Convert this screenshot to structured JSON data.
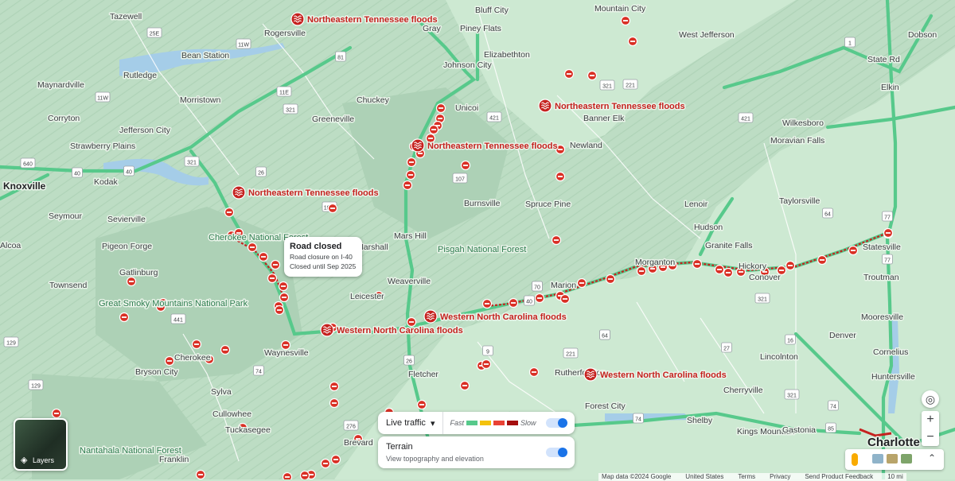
{
  "colors": {
    "highway": "#57c98b",
    "traffic_red": "#c5221f",
    "event": "#c5221f",
    "water": "#a5cde8"
  },
  "cities": [
    {
      "name": "Tazewell"
    },
    {
      "name": "Rogersville"
    },
    {
      "name": "Bean Station"
    },
    {
      "name": "Maynardville"
    },
    {
      "name": "Rutledge"
    },
    {
      "name": "Morristown"
    },
    {
      "name": "Corryton"
    },
    {
      "name": "Jefferson City"
    },
    {
      "name": "Strawberry Plains"
    },
    {
      "name": "Kodak"
    },
    {
      "name": "Seymour"
    },
    {
      "name": "Sevierville"
    },
    {
      "name": "Pigeon Forge"
    },
    {
      "name": "Gatlinburg"
    },
    {
      "name": "Townsend"
    },
    {
      "name": "Alcoa"
    },
    {
      "name": "Bluff City"
    },
    {
      "name": "Piney Flats"
    },
    {
      "name": "Gray"
    },
    {
      "name": "Johnson City"
    },
    {
      "name": "Elizabethton"
    },
    {
      "name": "Unicoi"
    },
    {
      "name": "Chuckey"
    },
    {
      "name": "Greeneville"
    },
    {
      "name": "Mountain City"
    },
    {
      "name": "West Jefferson"
    },
    {
      "name": "Banner Elk"
    },
    {
      "name": "Newland"
    },
    {
      "name": "Burnsville"
    },
    {
      "name": "Spruce Pine"
    },
    {
      "name": "Mars Hill"
    },
    {
      "name": "Marshall"
    },
    {
      "name": "Weaverville"
    },
    {
      "name": "Leicester"
    },
    {
      "name": "Waynesville"
    },
    {
      "name": "Cherokee"
    },
    {
      "name": "Bryson City"
    },
    {
      "name": "Sylva"
    },
    {
      "name": "Cullowhee"
    },
    {
      "name": "Tuckasegee"
    },
    {
      "name": "Franklin"
    },
    {
      "name": "Fletcher"
    },
    {
      "name": "Brevard"
    },
    {
      "name": "Marion"
    },
    {
      "name": "Morganton"
    },
    {
      "name": "Rutherfordton"
    },
    {
      "name": "Forest City"
    },
    {
      "name": "Shelby"
    },
    {
      "name": "Kings Mountain"
    },
    {
      "name": "Gastonia"
    },
    {
      "name": "Cherryville"
    },
    {
      "name": "Lincolnton"
    },
    {
      "name": "Denver"
    },
    {
      "name": "Cornelius"
    },
    {
      "name": "Huntersville"
    },
    {
      "name": "Mooresville"
    },
    {
      "name": "Troutman"
    },
    {
      "name": "Statesville"
    },
    {
      "name": "Hickory"
    },
    {
      "name": "Conover"
    },
    {
      "name": "Granite Falls"
    },
    {
      "name": "Hudson"
    },
    {
      "name": "Lenoir"
    },
    {
      "name": "Taylorsville"
    },
    {
      "name": "Wilkesboro"
    },
    {
      "name": "Moravian Falls"
    },
    {
      "name": "Elkin"
    },
    {
      "name": "State Rd"
    },
    {
      "name": "Dobson"
    },
    {
      "name": "Knoxville"
    },
    {
      "name": "Charlotte"
    }
  ],
  "parks": [
    {
      "name": "Cherokee National Forest"
    },
    {
      "name": "Great Smoky Mountains National Park"
    },
    {
      "name": "Pisgah National Forest"
    },
    {
      "name": "Nantahala National Forest"
    }
  ],
  "events": [
    {
      "name": "Northeastern Tennessee floods"
    },
    {
      "name": "Northeastern Tennessee floods"
    },
    {
      "name": "Northeastern Tennessee floods"
    },
    {
      "name": "Northeastern Tennessee floods"
    },
    {
      "name": "Western North Carolina floods"
    },
    {
      "name": "Western North Carolina floods"
    },
    {
      "name": "Western North Carolina floods"
    }
  ],
  "popup": {
    "title": "Road closed",
    "line1": "Road closure on I-40",
    "line2": "Closed until Sep 2025"
  },
  "traffic_panel": {
    "label": "Live traffic",
    "fast": "Fast",
    "slow": "Slow",
    "toggle_on": true
  },
  "terrain_panel": {
    "title": "Terrain",
    "subtitle": "View topography and elevation",
    "toggle_on": true
  },
  "layers_button": {
    "label": "Layers"
  },
  "shields": [
    "25E",
    "11W",
    "81",
    "11W",
    "11E",
    "321",
    "640",
    "40",
    "40",
    "321",
    "26",
    "19W",
    "107",
    "421",
    "221",
    "321",
    "421",
    "77",
    "77",
    "64",
    "70",
    "40",
    "321",
    "74",
    "441",
    "129",
    "26",
    "9",
    "221",
    "74",
    "64",
    "27",
    "16",
    "321",
    "74",
    "276",
    "85",
    "129",
    "64",
    "70",
    "1"
  ],
  "footer": {
    "data": "Map data ©2024 Google",
    "country": "United States",
    "terms": "Terms",
    "privacy": "Privacy",
    "feedback": "Send Product Feedback",
    "scale": "10 mi"
  }
}
